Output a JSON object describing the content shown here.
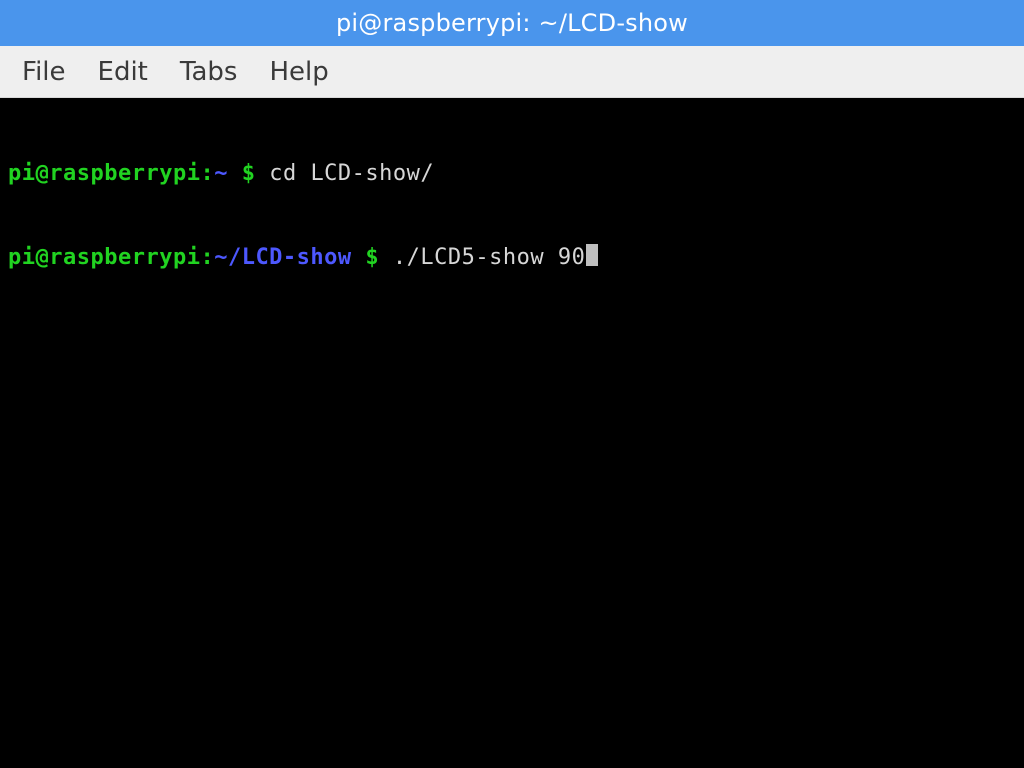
{
  "titlebar": {
    "text": "pi@raspberrypi: ~/LCD-show"
  },
  "menubar": {
    "items": [
      "File",
      "Edit",
      "Tabs",
      "Help"
    ]
  },
  "terminal": {
    "lines": [
      {
        "user": "pi",
        "at": "@",
        "host": "raspberrypi",
        "colon": ":",
        "path": "~",
        "dollar": " $ ",
        "command": "cd LCD-show/",
        "cursor": false
      },
      {
        "user": "pi",
        "at": "@",
        "host": "raspberrypi",
        "colon": ":",
        "path": "~/LCD-show",
        "dollar": " $ ",
        "command": "./LCD5-show 90",
        "cursor": true
      }
    ]
  },
  "colors": {
    "titlebar_bg": "#4a95ec",
    "titlebar_fg": "#ffffff",
    "menubar_bg": "#efefef",
    "terminal_bg": "#000000",
    "prompt_user": "#21d321",
    "prompt_path": "#4d58ff",
    "text": "#d7d7d7",
    "cursor": "#bfbfbf"
  }
}
